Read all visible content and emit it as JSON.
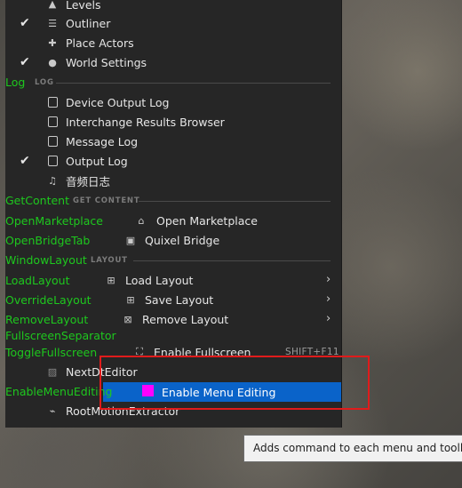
{
  "window_menu": {
    "items_top": [
      {
        "label": "Levels",
        "checked": false,
        "icon": "levels-icon"
      },
      {
        "label": "Outliner",
        "checked": true,
        "icon": "outliner-icon"
      },
      {
        "label": "Place Actors",
        "checked": false,
        "icon": "place-actors-icon"
      },
      {
        "label": "World Settings",
        "checked": true,
        "icon": "world-icon"
      }
    ],
    "log_section": {
      "debug_name": "Log",
      "heading": "LOG",
      "items": [
        {
          "label": "Device Output Log",
          "checked": false,
          "icon": "log-icon"
        },
        {
          "label": "Interchange Results Browser",
          "checked": false,
          "icon": "log-icon"
        },
        {
          "label": "Message Log",
          "checked": false,
          "icon": "log-icon"
        },
        {
          "label": "Output Log",
          "checked": true,
          "icon": "log-icon"
        },
        {
          "label": "音频日志",
          "checked": false,
          "icon": "audio-log-icon"
        }
      ]
    },
    "get_content_section": {
      "debug_name": "GetContent",
      "heading": "GET CONTENT",
      "items": [
        {
          "debug_name": "OpenMarketplace",
          "label": "Open Marketplace",
          "icon": "marketplace-icon"
        },
        {
          "debug_name": "OpenBridgeTab",
          "label": "Quixel Bridge",
          "icon": "bridge-icon"
        }
      ]
    },
    "layout_section": {
      "debug_name": "WindowLayout",
      "heading": "LAYOUT",
      "items": [
        {
          "debug_name": "LoadLayout",
          "label": "Load Layout",
          "icon": "load-layout-icon",
          "submenu": true
        },
        {
          "debug_name": "OverrideLayout",
          "label": "Save Layout",
          "icon": "save-layout-icon",
          "submenu": true
        },
        {
          "debug_name": "RemoveLayout",
          "label": "Remove Layout",
          "icon": "remove-layout-icon",
          "submenu": true
        }
      ],
      "separator_debug_name": "FullscreenSeparator",
      "fullscreen": {
        "debug_name": "ToggleFullscreen",
        "label": "Enable Fullscreen",
        "shortcut": "SHIFT+F11",
        "icon": "fullscreen-icon"
      }
    },
    "next_dt_editor": {
      "label": "NextDtEditor",
      "icon": "hatch-icon"
    },
    "enable_menu_editing": {
      "debug_name": "EnableMenuEditing",
      "label": "Enable Menu Editing",
      "highlighted": true
    },
    "root_motion": {
      "label": "RootMotionExtractor",
      "icon": "root-motion-icon"
    }
  },
  "tooltip": {
    "text": "Adds command to each menu and toolbar fo"
  },
  "colors": {
    "debug_green": "#1ec81e",
    "highlight": "#0a63c9",
    "annotation_red": "#e01b1b",
    "menu_bg": "#262626"
  }
}
